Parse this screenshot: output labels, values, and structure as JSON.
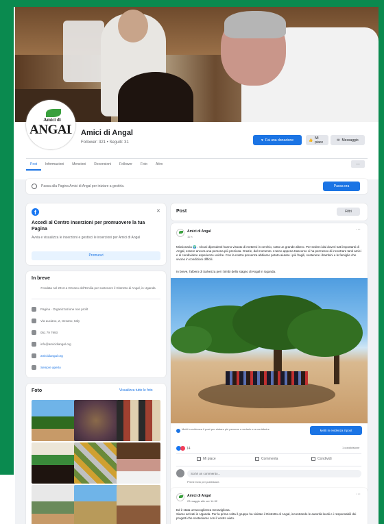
{
  "page": {
    "name": "Amici di Angal",
    "stats": "Follower: 321 • Seguiti: 31",
    "logo": {
      "top_text": "Amici di",
      "big_text": "ANGAL",
      "sub_text": "ODV"
    }
  },
  "header_buttons": {
    "follow": "Fai una donazione",
    "like": "Mi piace",
    "message": "Messaggio"
  },
  "tabs": [
    "Post",
    "Informazioni",
    "Menzioni",
    "Recensioni",
    "Follower",
    "Foto",
    "Altro"
  ],
  "more_tab_icon": "…",
  "promo": {
    "text": "Passa alla Pagina Amici di Angal per iniziare a gestirla.",
    "button": "Passa ora"
  },
  "fb_card": {
    "title": "Accedi al Centro inserzioni per promuovere la tua Pagina",
    "desc": "Avvia e visualizza le inserzioni e gestisci le inserzioni per Amici di Angal",
    "button": "Promuovi"
  },
  "intro": {
    "title": "In breve",
    "desc": "Fondata nel 2013 a Ozzano dell'Emilia per sostenere il Distretto di Angal, in Uganda",
    "rows": [
      {
        "icon": "page-icon",
        "text": "Pagina · Organizzazione non profit"
      },
      {
        "icon": "location-icon",
        "text": "Via Luciano, 2, Ozzano, Italy"
      },
      {
        "icon": "phone-icon",
        "text": "051 79 7993"
      },
      {
        "icon": "mail-icon",
        "text": "info@amicidiangal.org"
      },
      {
        "icon": "link-icon",
        "text": "amicidiangal.org"
      },
      {
        "icon": "info-icon",
        "text": "Sempre aperto"
      }
    ]
  },
  "photos": {
    "title": "Foto",
    "see_all": "Visualizza tutte le foto"
  },
  "posts_header": {
    "title": "Post",
    "filter": "Filtri"
  },
  "post1": {
    "author": "Amici di Angal",
    "date": "11 h",
    "text": "Missionaria 🌍 . Alcuni dipendenti hanno vissuto di mettersi in cerchio, sotto un grande albero. Per sederci dai doveri tutti importanti di Angal, essere ancora una persona più preziosa. Grazie, dal momento. L'anno appena trascorso ci ha permesso di incontrare tanti amici e di condividere esperienze uniche. Con la nostra presenza abbiamo potuto aiutare i più fragili, sostenere i bambini e le famiglie che vivono in condizioni difficili.",
    "text2": "In breve, l'albero di Salvezza per i bimbi dello stagno di Angal in Uganda.",
    "promo_text": "Metti in evidenza il post per aiutare più persone a vederlo e a contribuire",
    "promo_button": "Metti in evidenza il post",
    "reactions": "14",
    "shares": "1 condivisione",
    "actions": [
      "Mi piace",
      "Commenta",
      "Condividi"
    ],
    "comment_placeholder": "Scrivi un commento...",
    "comment_hint": "Premi Invio per pubblicare."
  },
  "post2": {
    "author": "Amici di Angal",
    "date": "23 maggio alle ore 14:32",
    "text": "Siamo arrivati in Uganda. Per la prima volta il gruppo ha visitato il Distretto di Angal, incontrando le autorità locali e i responsabili dei progetti che sosteniamo con il vostro aiuto.",
    "text2": "Ed è stata un'accoglienza meravigliosa."
  }
}
